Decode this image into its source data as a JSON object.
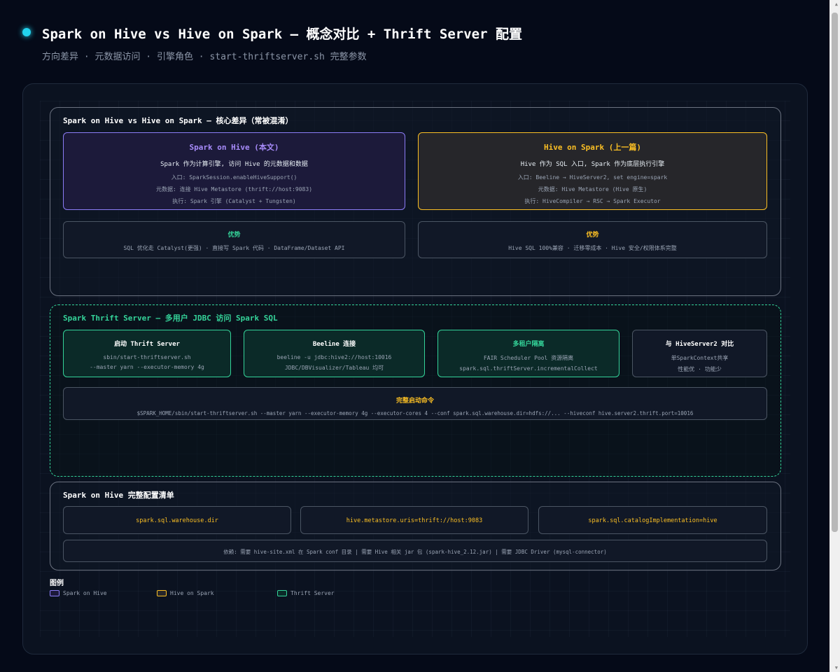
{
  "header": {
    "title": "Spark on Hive vs Hive on Spark — 概念对比 + Thrift Server 配置",
    "subtitle": "方向差异 · 元数据访问 · 引擎角色 · start-thriftserver.sh 完整参数"
  },
  "section1": {
    "title": "Spark on Hive vs Hive on Spark — 核心差异（常被混淆）",
    "spark_on_hive": {
      "title": "Spark on Hive (本文)",
      "desc": "Spark 作为计算引擎, 访问 Hive 的元数据和数据",
      "entry": "入口: SparkSession.enableHiveSupport()",
      "metadata": "元数据: 连接 Hive Metastore (thrift://host:9083)",
      "execution": "执行: Spark 引擎 (Catalyst + Tungsten)"
    },
    "hive_on_spark": {
      "title": "Hive on Spark (上一篇)",
      "desc": "Hive 作为 SQL 入口, Spark 作为底层执行引擎",
      "entry": "入口: Beeline → HiveServer2, set engine=spark",
      "metadata": "元数据: Hive Metastore (Hive 原生)",
      "execution": "执行: HiveCompiler → RSC → Spark Executor"
    },
    "adv_left": {
      "title": "优势",
      "text": "SQL 优化走 Catalyst(更强) · 直接写 Spark 代码 · DataFrame/Dataset API"
    },
    "adv_right": {
      "title": "优势",
      "text": "Hive SQL 100%兼容 · 迁移零成本 · Hive 安全/权限体系完整"
    }
  },
  "section2": {
    "title": "Spark Thrift Server — 多用户 JDBC 访问 Spark SQL",
    "start": {
      "title": "启动 Thrift Server",
      "line1": "sbin/start-thriftserver.sh",
      "line2": "--master yarn --executor-memory 4g"
    },
    "beeline": {
      "title": "Beeline 连接",
      "line1": "beeline -u jdbc:hive2://host:10016",
      "line2": "JDBC/DBVisualizer/Tableau 均可"
    },
    "multi_tenant": {
      "title": "多租户隔离",
      "line1": "FAIR Scheduler Pool 资源隔离",
      "line2": "spark.sql.thriftServer.incrementalCollect"
    },
    "compare": {
      "title": "与 HiveServer2 对比",
      "line1": "单SparkContext共享",
      "line2": "性能优 · 功能少"
    },
    "command": {
      "title": "完整启动命令",
      "text": "$SPARK_HOME/sbin/start-thriftserver.sh --master yarn --executor-memory 4g --executor-cores 4 --conf spark.sql.warehouse.dir=hdfs://... --hiveconf hive.server2.thrift.port=10016"
    }
  },
  "section3": {
    "title": "Spark on Hive 完整配置清单",
    "configs": [
      "spark.sql.warehouse.dir",
      "hive.metastore.uris=thrift://host:9083",
      "spark.sql.catalogImplementation=hive"
    ],
    "dependencies": "依赖: 需要 hive-site.xml 在 Spark conf 目录 | 需要 Hive 相关 jar 包 (spark-hive_2.12.jar) | 需要 JDBC Driver (mysql-connector)"
  },
  "legend": {
    "title": "图例",
    "items": [
      {
        "label": "Spark on Hive",
        "color": "#8b7cf6"
      },
      {
        "label": "Hive on Spark",
        "color": "#fbbf24"
      },
      {
        "label": "Thrift Server",
        "color": "#34d399"
      }
    ]
  },
  "colors": {
    "accent_cyan": "#22d3ee",
    "purple": "#8b7cf6",
    "amber": "#fbbf24",
    "green": "#34d399"
  }
}
